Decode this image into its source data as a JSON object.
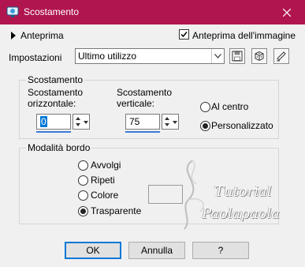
{
  "window": {
    "title": "Scostamento",
    "accent": "#b0154f",
    "icon": "app-icon"
  },
  "preview": {
    "label": "Anteprima",
    "image_preview_label": "Anteprima dell'immagine",
    "image_preview_checked": true
  },
  "presets": {
    "label": "Impostazioni",
    "value": "Ultimo utilizzo",
    "tool_icons": [
      "save-icon",
      "dice-icon",
      "reset-icon"
    ]
  },
  "offset": {
    "title": "Scostamento",
    "horizontal_label_1": "Scostamento",
    "horizontal_label_2": "orizzontale:",
    "horizontal_value": "0",
    "vertical_label_1": "Scostamento",
    "vertical_label_2": "verticale:",
    "vertical_value": "75",
    "options": [
      {
        "label": "Al centro",
        "selected": false
      },
      {
        "label": "Personalizzato",
        "selected": true
      }
    ]
  },
  "edge_mode": {
    "title": "Modalità bordo",
    "options": [
      {
        "label": "Avvolgi",
        "selected": false
      },
      {
        "label": "Ripeti",
        "selected": false
      },
      {
        "label": "Colore",
        "selected": false
      },
      {
        "label": "Trasparente",
        "selected": true
      }
    ]
  },
  "buttons": {
    "ok": "OK",
    "cancel": "Annulla",
    "help": "?"
  },
  "watermark": {
    "line1": "Tutorial",
    "line2": "Paolapaola"
  }
}
